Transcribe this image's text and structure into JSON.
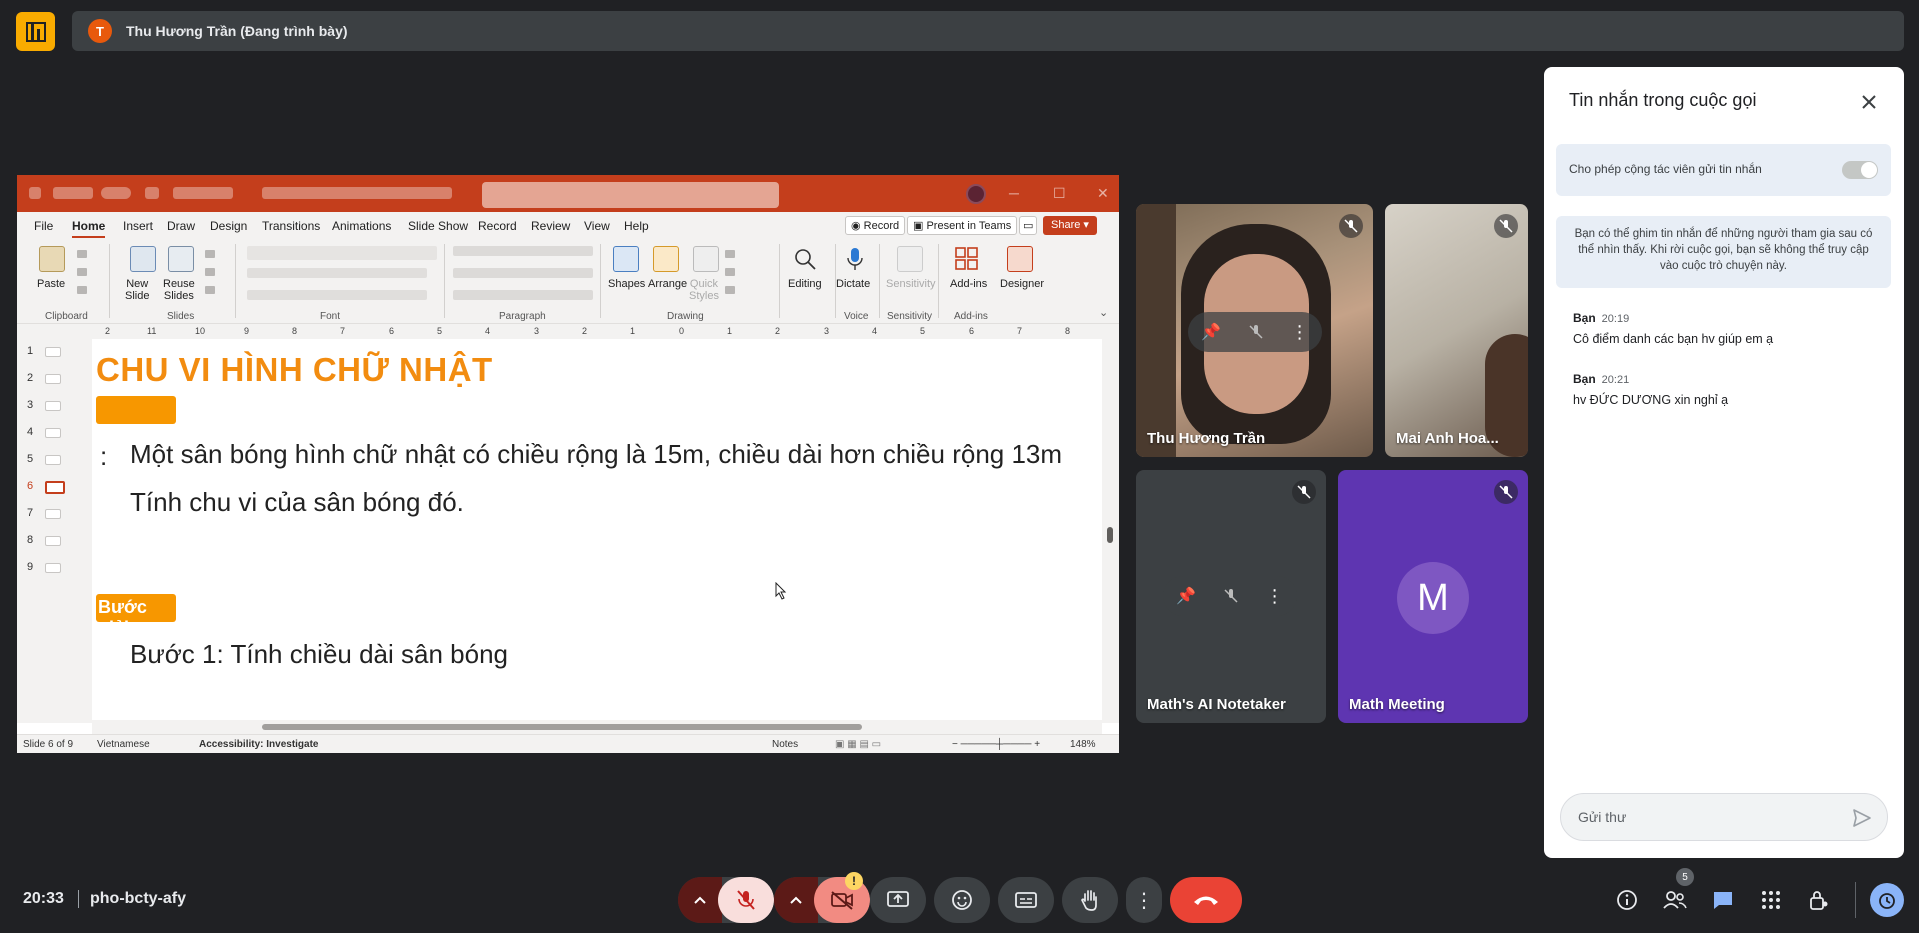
{
  "topbar": {
    "presenter_initial": "T",
    "presenter_label": "Thu Hương Trần (Đang trình bày)"
  },
  "ppt": {
    "tabs": [
      "File",
      "Home",
      "Insert",
      "Draw",
      "Design",
      "Transitions",
      "Animations",
      "Slide Show",
      "Record",
      "Review",
      "View",
      "Help"
    ],
    "record_btn": "Record",
    "present_teams_btn": "Present in Teams",
    "share_btn": "Share",
    "ribbon": {
      "paste": "Paste",
      "new_slide": "New\nSlide",
      "reuse_slides": "Reuse\nSlides",
      "shapes": "Shapes",
      "arrange": "Arrange",
      "quick_styles": "Quick\nStyles",
      "editing": "Editing",
      "dictate": "Dictate",
      "sensitivity": "Sensitivity",
      "addins": "Add-ins",
      "designer": "Designer",
      "groups": [
        "Clipboard",
        "Slides",
        "Font",
        "Paragraph",
        "Drawing",
        "Voice",
        "Sensitivity",
        "Add-ins"
      ]
    },
    "slide_numbers": [
      "1",
      "2",
      "3",
      "4",
      "5",
      "6",
      "7",
      "8",
      "9"
    ],
    "slide": {
      "title": "CHU VI HÌNH CHỮ NHẬT",
      "problem_marker": ":",
      "line1": "Một sân bóng hình chữ nhật có chiều rộng là 15m, chiều dài hơn chiều rộng 13m",
      "line2": "Tính chu vi của sân bóng đó.",
      "steps_tag": "Bước giải",
      "step1": "Bước 1: Tính chiều dài sân bóng"
    },
    "status": {
      "slide_of": "Slide 6 of 9",
      "language": "Vietnamese",
      "accessibility": "Accessibility: Investigate",
      "notes": "Notes",
      "zoom": "148%"
    }
  },
  "participants": [
    {
      "name": "Thu Hương Trần"
    },
    {
      "name": "Mai Anh Hoa..."
    },
    {
      "name": "Math's AI Notetaker"
    },
    {
      "name": "Math Meeting",
      "initial": "M"
    }
  ],
  "chat": {
    "title": "Tin nhắn trong cuộc gọi",
    "allow_label": "Cho phép cộng tác viên gửi tin nhắn",
    "info": "Bạn có thể ghim tin nhắn để những người tham gia sau có thể nhìn thấy. Khi rời cuộc gọi, bạn sẽ không thể truy cập vào cuộc trò chuyện này.",
    "messages": [
      {
        "sender": "Bạn",
        "time": "20:19",
        "text": "Cô điểm danh các bạn hv giúp em ạ"
      },
      {
        "sender": "Bạn",
        "time": "20:21",
        "text": "hv ĐỨC DƯƠNG xin nghỉ ạ"
      }
    ],
    "input_placeholder": "Gửi thư"
  },
  "bottombar": {
    "time": "20:33",
    "meeting_code": "pho-bcty-afy",
    "people_count": "5",
    "camera_warning": "!"
  },
  "colors": {
    "ppt_accent": "#c43e1c",
    "slide_title": "#f28c10",
    "end_call": "#ea4335",
    "chat_active": "#8ab4f8"
  }
}
